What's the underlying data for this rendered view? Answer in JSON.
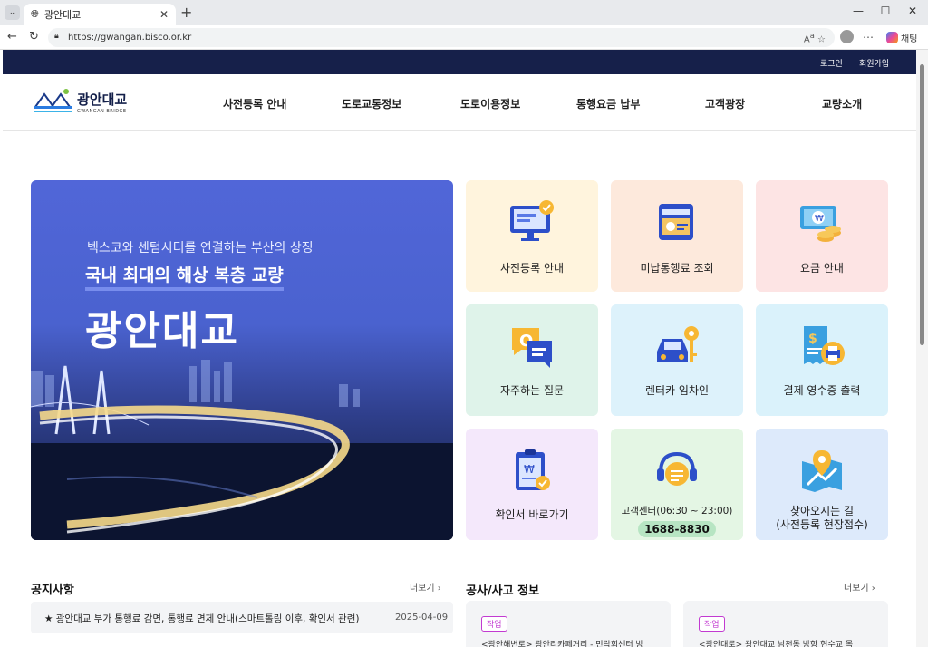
{
  "browser": {
    "tab_title": "광안대교",
    "url": "https://gwangan.bisco.or.kr",
    "chat_label": "채팅"
  },
  "topbar": {
    "login": "로그인",
    "join": "회원가입"
  },
  "brand": {
    "name_ko": "광안대교",
    "name_en": "GWANGAN BRIDGE"
  },
  "nav": [
    "사전등록 안내",
    "도로교통정보",
    "도로이용정보",
    "통행요금 납부",
    "고객광장",
    "교량소개"
  ],
  "hero": {
    "subtitle": "벡스코와 센텀시티를 연결하는 부산의 상징",
    "headline": "국내 최대의 해상 복층 교량",
    "title": "광안대교"
  },
  "cards": [
    {
      "label": "사전등록 안내",
      "icon": "monitor-check-icon",
      "bg": "#fff4dd"
    },
    {
      "label": "미납통행료 조회",
      "icon": "payment-terminal-icon",
      "bg": "#fde9dc"
    },
    {
      "label": "요금 안내",
      "icon": "won-coins-icon",
      "bg": "#fde4e4"
    },
    {
      "label": "자주하는 질문",
      "icon": "chat-question-icon",
      "bg": "#dff3ea"
    },
    {
      "label": "렌터카 임차인",
      "icon": "car-key-icon",
      "bg": "#ddf2fb"
    },
    {
      "label": "결제 영수증 출력",
      "icon": "receipt-print-icon",
      "bg": "#daf2fb"
    },
    {
      "label": "확인서 바로가기",
      "icon": "clipboard-won-icon",
      "bg": "#f4e8fb"
    },
    {
      "label": "고객센터(06:30 ~ 23:00)",
      "phone": "1688-8830",
      "icon": "headset-icon",
      "bg": "#e4f6e4"
    },
    {
      "label": "찾아오시는 길",
      "label2": "(사전등록 현장접수)",
      "icon": "map-pin-icon",
      "bg": "#ddeafb"
    }
  ],
  "notice": {
    "title": "공지사항",
    "more": "더보기",
    "items": [
      {
        "text": "★ 광안대교 부가 통행료 감면, 통행료 면제 안내(스마트톨링 이후, 확인서 관련)",
        "date": "2025-04-09"
      }
    ]
  },
  "works": {
    "title": "공사/사고 정보",
    "more": "더보기",
    "items": [
      {
        "badge": "작업",
        "text": "<광안해변로> 광안리카페거리 - 민락회센터 방"
      },
      {
        "badge": "작업",
        "text": "<광안대로> 광안대교 남천동 방향 현수교 목"
      }
    ]
  }
}
